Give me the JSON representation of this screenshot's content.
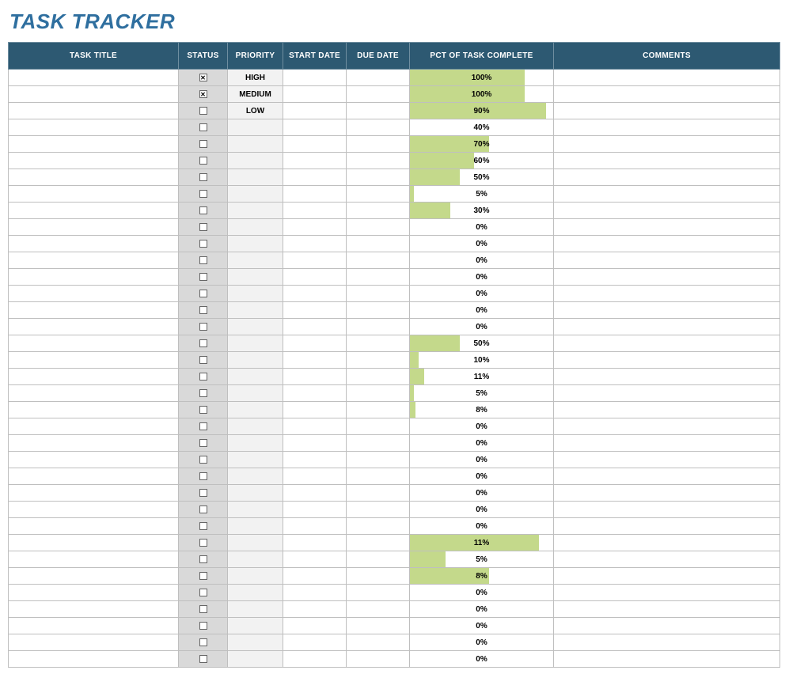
{
  "title": "TASK TRACKER",
  "columns": {
    "task_title": "TASK TITLE",
    "status": "STATUS",
    "priority": "PRIORITY",
    "start_date": "START DATE",
    "due_date": "DUE DATE",
    "pct_complete": "PCT OF TASK COMPLETE",
    "comments": "COMMENTS"
  },
  "rows": [
    {
      "task_title": "",
      "status_checked": true,
      "priority": "HIGH",
      "start_date": "",
      "due_date": "",
      "pct_complete": 100,
      "bar_pct": 80,
      "comments": ""
    },
    {
      "task_title": "",
      "status_checked": true,
      "priority": "MEDIUM",
      "start_date": "",
      "due_date": "",
      "pct_complete": 100,
      "bar_pct": 80,
      "comments": ""
    },
    {
      "task_title": "",
      "status_checked": false,
      "priority": "LOW",
      "start_date": "",
      "due_date": "",
      "pct_complete": 90,
      "bar_pct": 95,
      "comments": ""
    },
    {
      "task_title": "",
      "status_checked": false,
      "priority": "",
      "start_date": "",
      "due_date": "",
      "pct_complete": 40,
      "bar_pct": 0,
      "comments": ""
    },
    {
      "task_title": "",
      "status_checked": false,
      "priority": "",
      "start_date": "",
      "due_date": "",
      "pct_complete": 70,
      "bar_pct": 55,
      "comments": ""
    },
    {
      "task_title": "",
      "status_checked": false,
      "priority": "",
      "start_date": "",
      "due_date": "",
      "pct_complete": 60,
      "bar_pct": 45,
      "comments": ""
    },
    {
      "task_title": "",
      "status_checked": false,
      "priority": "",
      "start_date": "",
      "due_date": "",
      "pct_complete": 50,
      "bar_pct": 35,
      "comments": ""
    },
    {
      "task_title": "",
      "status_checked": false,
      "priority": "",
      "start_date": "",
      "due_date": "",
      "pct_complete": 5,
      "bar_pct": 3,
      "comments": ""
    },
    {
      "task_title": "",
      "status_checked": false,
      "priority": "",
      "start_date": "",
      "due_date": "",
      "pct_complete": 30,
      "bar_pct": 28,
      "comments": ""
    },
    {
      "task_title": "",
      "status_checked": false,
      "priority": "",
      "start_date": "",
      "due_date": "",
      "pct_complete": 0,
      "bar_pct": 0,
      "comments": ""
    },
    {
      "task_title": "",
      "status_checked": false,
      "priority": "",
      "start_date": "",
      "due_date": "",
      "pct_complete": 0,
      "bar_pct": 0,
      "comments": ""
    },
    {
      "task_title": "",
      "status_checked": false,
      "priority": "",
      "start_date": "",
      "due_date": "",
      "pct_complete": 0,
      "bar_pct": 0,
      "comments": ""
    },
    {
      "task_title": "",
      "status_checked": false,
      "priority": "",
      "start_date": "",
      "due_date": "",
      "pct_complete": 0,
      "bar_pct": 0,
      "comments": ""
    },
    {
      "task_title": "",
      "status_checked": false,
      "priority": "",
      "start_date": "",
      "due_date": "",
      "pct_complete": 0,
      "bar_pct": 0,
      "comments": ""
    },
    {
      "task_title": "",
      "status_checked": false,
      "priority": "",
      "start_date": "",
      "due_date": "",
      "pct_complete": 0,
      "bar_pct": 0,
      "comments": ""
    },
    {
      "task_title": "",
      "status_checked": false,
      "priority": "",
      "start_date": "",
      "due_date": "",
      "pct_complete": 0,
      "bar_pct": 0,
      "comments": ""
    },
    {
      "task_title": "",
      "status_checked": false,
      "priority": "",
      "start_date": "",
      "due_date": "",
      "pct_complete": 50,
      "bar_pct": 35,
      "comments": ""
    },
    {
      "task_title": "",
      "status_checked": false,
      "priority": "",
      "start_date": "",
      "due_date": "",
      "pct_complete": 10,
      "bar_pct": 6,
      "comments": ""
    },
    {
      "task_title": "",
      "status_checked": false,
      "priority": "",
      "start_date": "",
      "due_date": "",
      "pct_complete": 11,
      "bar_pct": 10,
      "comments": ""
    },
    {
      "task_title": "",
      "status_checked": false,
      "priority": "",
      "start_date": "",
      "due_date": "",
      "pct_complete": 5,
      "bar_pct": 3,
      "comments": ""
    },
    {
      "task_title": "",
      "status_checked": false,
      "priority": "",
      "start_date": "",
      "due_date": "",
      "pct_complete": 8,
      "bar_pct": 4,
      "comments": ""
    },
    {
      "task_title": "",
      "status_checked": false,
      "priority": "",
      "start_date": "",
      "due_date": "",
      "pct_complete": 0,
      "bar_pct": 0,
      "comments": ""
    },
    {
      "task_title": "",
      "status_checked": false,
      "priority": "",
      "start_date": "",
      "due_date": "",
      "pct_complete": 0,
      "bar_pct": 0,
      "comments": ""
    },
    {
      "task_title": "",
      "status_checked": false,
      "priority": "",
      "start_date": "",
      "due_date": "",
      "pct_complete": 0,
      "bar_pct": 0,
      "comments": ""
    },
    {
      "task_title": "",
      "status_checked": false,
      "priority": "",
      "start_date": "",
      "due_date": "",
      "pct_complete": 0,
      "bar_pct": 0,
      "comments": ""
    },
    {
      "task_title": "",
      "status_checked": false,
      "priority": "",
      "start_date": "",
      "due_date": "",
      "pct_complete": 0,
      "bar_pct": 0,
      "comments": ""
    },
    {
      "task_title": "",
      "status_checked": false,
      "priority": "",
      "start_date": "",
      "due_date": "",
      "pct_complete": 0,
      "bar_pct": 0,
      "comments": ""
    },
    {
      "task_title": "",
      "status_checked": false,
      "priority": "",
      "start_date": "",
      "due_date": "",
      "pct_complete": 0,
      "bar_pct": 0,
      "comments": ""
    },
    {
      "task_title": "",
      "status_checked": false,
      "priority": "",
      "start_date": "",
      "due_date": "",
      "pct_complete": 11,
      "bar_pct": 90,
      "comments": ""
    },
    {
      "task_title": "",
      "status_checked": false,
      "priority": "",
      "start_date": "",
      "due_date": "",
      "pct_complete": 5,
      "bar_pct": 25,
      "comments": ""
    },
    {
      "task_title": "",
      "status_checked": false,
      "priority": "",
      "start_date": "",
      "due_date": "",
      "pct_complete": 8,
      "bar_pct": 55,
      "comments": ""
    },
    {
      "task_title": "",
      "status_checked": false,
      "priority": "",
      "start_date": "",
      "due_date": "",
      "pct_complete": 0,
      "bar_pct": 0,
      "comments": ""
    },
    {
      "task_title": "",
      "status_checked": false,
      "priority": "",
      "start_date": "",
      "due_date": "",
      "pct_complete": 0,
      "bar_pct": 0,
      "comments": ""
    },
    {
      "task_title": "",
      "status_checked": false,
      "priority": "",
      "start_date": "",
      "due_date": "",
      "pct_complete": 0,
      "bar_pct": 0,
      "comments": ""
    },
    {
      "task_title": "",
      "status_checked": false,
      "priority": "",
      "start_date": "",
      "due_date": "",
      "pct_complete": 0,
      "bar_pct": 0,
      "comments": ""
    },
    {
      "task_title": "",
      "status_checked": false,
      "priority": "",
      "start_date": "",
      "due_date": "",
      "pct_complete": 0,
      "bar_pct": 0,
      "comments": ""
    }
  ]
}
